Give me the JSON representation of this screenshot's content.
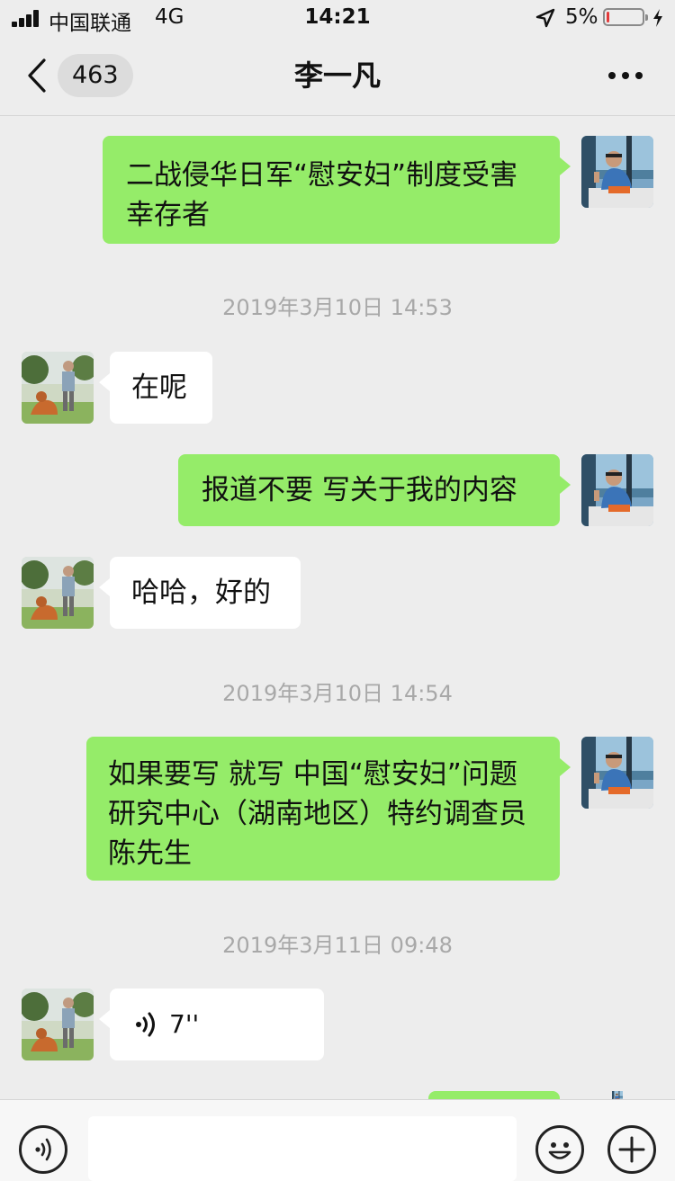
{
  "status_bar": {
    "carrier": "中国联通",
    "network": "4G",
    "time": "14:21",
    "battery_percent": "5%",
    "battery_level": 0.05,
    "icons": [
      "signal-icon",
      "location-arrow-icon",
      "battery-icon",
      "charging-bolt-icon"
    ]
  },
  "nav": {
    "back_icon": "chevron-left-icon",
    "unread_count": "463",
    "title": "李一凡",
    "more_icon": "ellipsis-icon"
  },
  "messages": [
    {
      "id": "m1",
      "side": "right",
      "type": "text",
      "text": "二战侵华日军“慰安妇”制度受害幸存者"
    },
    {
      "id": "t1",
      "type": "timestamp",
      "text": "2019年3月10日 14:53"
    },
    {
      "id": "m2",
      "side": "left",
      "type": "text",
      "text": "在呢"
    },
    {
      "id": "m3",
      "side": "right",
      "type": "text",
      "text": "报道不要 写关于我的内容"
    },
    {
      "id": "m4",
      "side": "left",
      "type": "text",
      "text": "哈哈，好的"
    },
    {
      "id": "t2",
      "type": "timestamp",
      "text": "2019年3月10日 14:54"
    },
    {
      "id": "m5",
      "side": "right",
      "type": "text",
      "text": "如果要写 就写 中国“慰安妇”问题研究中心（湖南地区）特约调查员 陈先生"
    },
    {
      "id": "t3",
      "type": "timestamp",
      "text": "2019年3月11日 09:48"
    },
    {
      "id": "m6",
      "side": "left",
      "type": "voice",
      "duration": "7''"
    }
  ],
  "input_bar": {
    "voice_icon": "voice-mode-icon",
    "input_value": "",
    "emoji_icon": "emoji-icon",
    "plus_icon": "plus-icon"
  },
  "colors": {
    "background": "#ededed",
    "self_bubble": "#95ec69",
    "other_bubble": "#ffffff",
    "timestamp_text": "#a8a8a8",
    "battery_low": "#e23a3a"
  }
}
